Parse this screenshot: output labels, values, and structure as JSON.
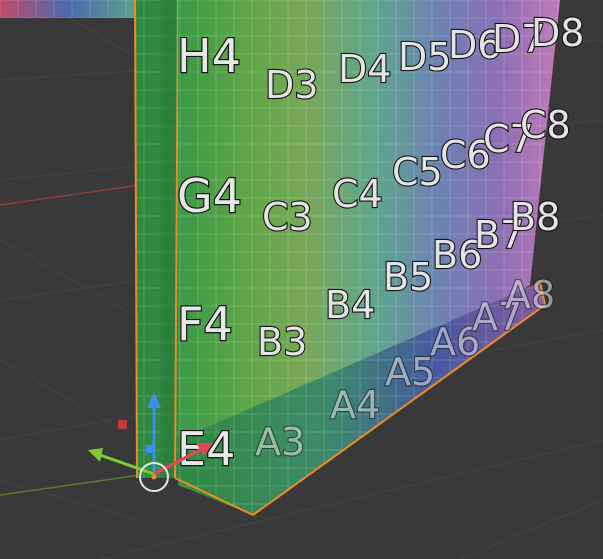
{
  "viewport": {
    "background": "#393939",
    "grid_color": "#4a4a4a",
    "x_axis_color": "#8f3a3a",
    "y_axis_color": "#5e7a2a",
    "selection_outline_color": "#f08a24"
  },
  "side_face_labels": [
    "H4",
    "G4",
    "F4",
    "E4"
  ],
  "front_face_labels": [
    [
      "D3",
      "D4",
      "D5",
      "D6",
      "D7",
      "D8"
    ],
    [
      "C3",
      "C4",
      "C5",
      "C6",
      "C7",
      "C8"
    ],
    [
      "B3",
      "B4",
      "B5",
      "B6",
      "B7",
      "B8"
    ]
  ],
  "lower_row_labels": [
    "A3",
    "A4",
    "A5",
    "A6",
    "A7",
    "A8"
  ],
  "gizmo": {
    "move_icon": "translate-arrows-icon",
    "pivot_icon": "pivot-circle-icon",
    "colors": {
      "x": "#e8455a",
      "y": "#7cc83a",
      "z": "#3b8ff0"
    }
  }
}
